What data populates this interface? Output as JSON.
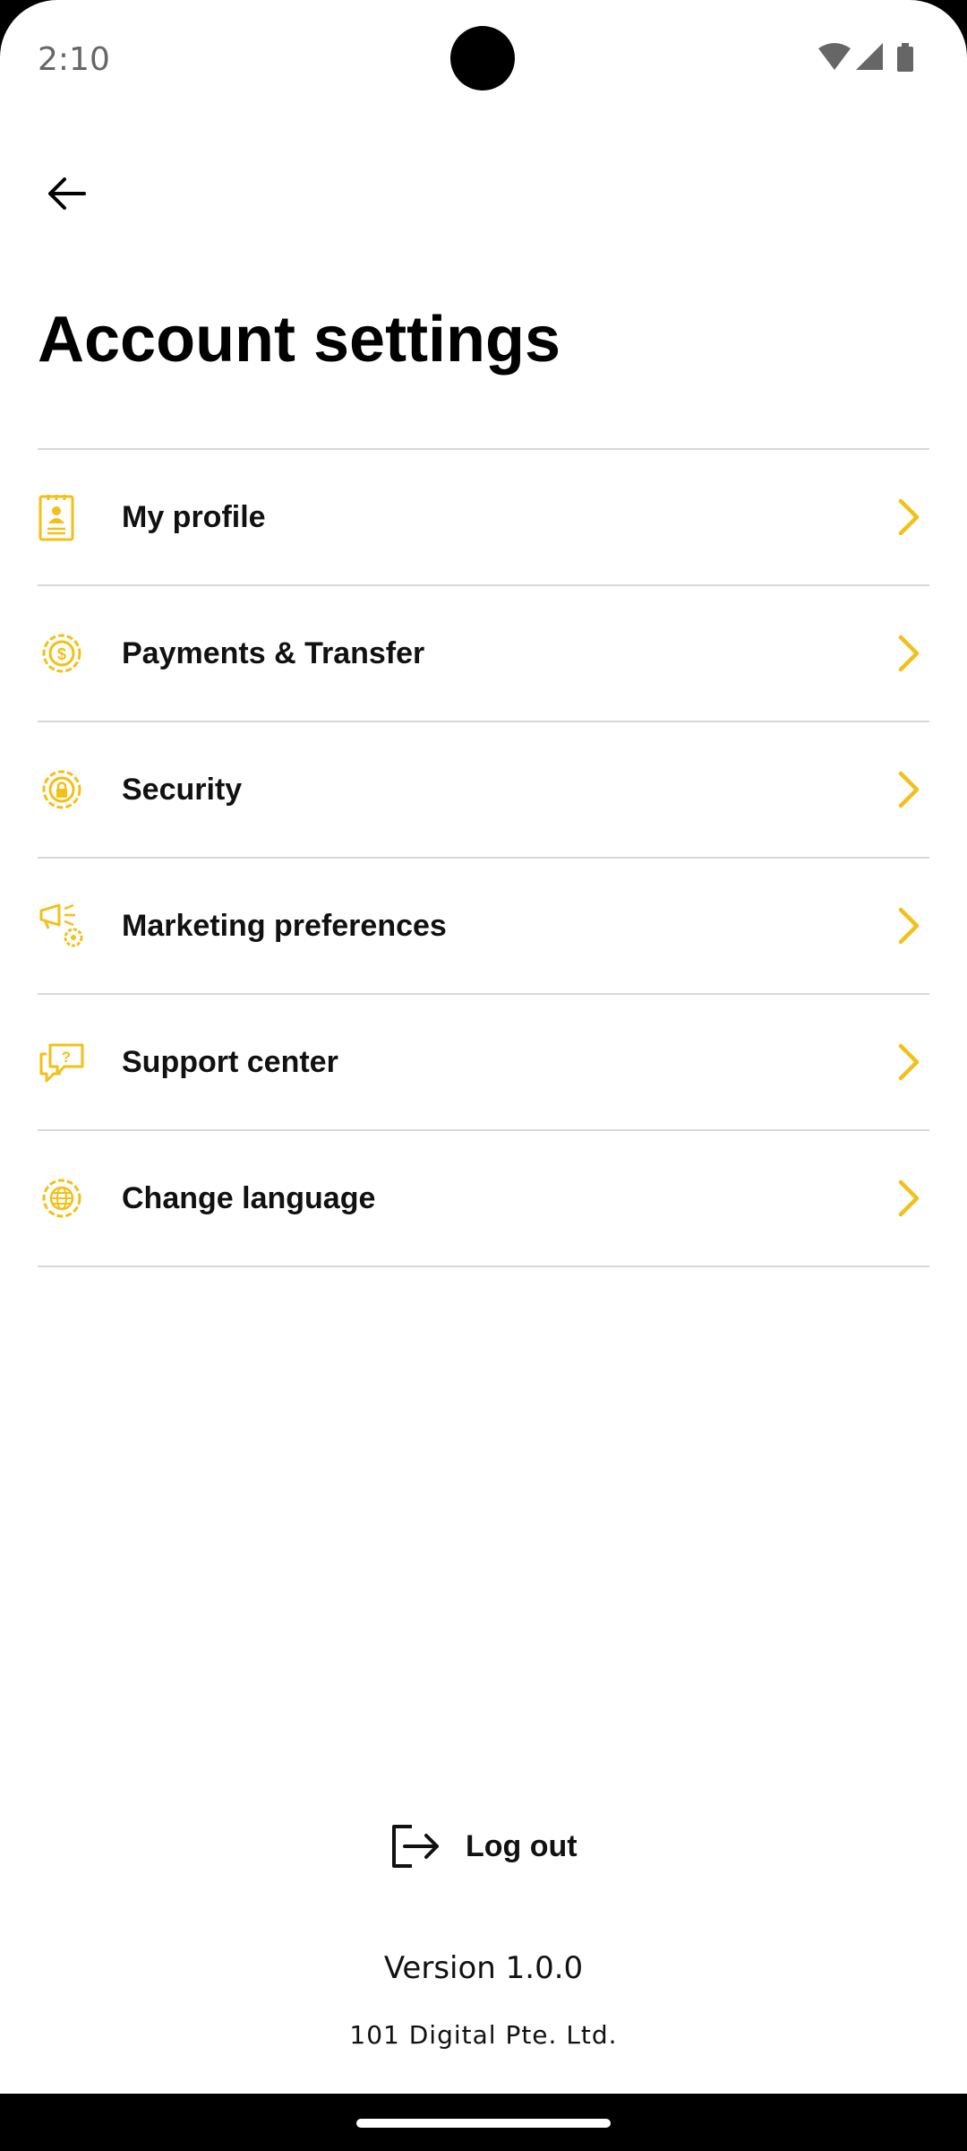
{
  "status_bar": {
    "time": "2:10"
  },
  "header": {
    "title": "Account settings"
  },
  "menu": {
    "items": [
      {
        "label": "My profile",
        "icon": "profile-card-icon"
      },
      {
        "label": "Payments & Transfer",
        "icon": "payment-gear-icon"
      },
      {
        "label": "Security",
        "icon": "lock-gear-icon"
      },
      {
        "label": "Marketing preferences",
        "icon": "megaphone-gear-icon"
      },
      {
        "label": "Support center",
        "icon": "chat-question-icon"
      },
      {
        "label": "Change language",
        "icon": "globe-gear-icon"
      }
    ]
  },
  "footer": {
    "logout_label": "Log out",
    "version": "Version 1.0.0",
    "company": "101 Digital Pte. Ltd."
  },
  "colors": {
    "accent": "#F2C018",
    "text": "#111111",
    "divider": "#D8D8D8"
  }
}
